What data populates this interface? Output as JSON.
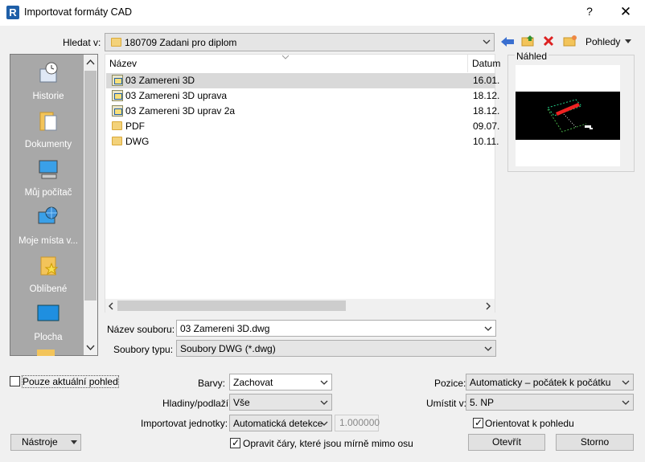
{
  "window": {
    "title": "Importovat formáty CAD",
    "help": "?",
    "close": "✕"
  },
  "lookin": {
    "label": "Hledat v:",
    "value": "180709 Zadani pro diplom"
  },
  "toolbar": {
    "views_label": "Pohledy"
  },
  "places": [
    {
      "label": "Historie",
      "icon": "history-icon"
    },
    {
      "label": "Dokumenty",
      "icon": "documents-icon"
    },
    {
      "label": "Můj počítač",
      "icon": "computer-icon"
    },
    {
      "label": "Moje místa v...",
      "icon": "network-icon"
    },
    {
      "label": "Oblíbené",
      "icon": "favorites-icon"
    },
    {
      "label": "Plocha",
      "icon": "desktop-icon"
    }
  ],
  "filelist": {
    "headers": {
      "name": "Název",
      "date": "Datum"
    },
    "rows": [
      {
        "name": "03 Zamereni 3D",
        "date": "16.01.",
        "type": "dwg",
        "selected": true
      },
      {
        "name": "03 Zamereni 3D uprava",
        "date": "18.12.",
        "type": "dwg"
      },
      {
        "name": "03 Zamereni 3D uprav 2a",
        "date": "18.12.",
        "type": "dwg"
      },
      {
        "name": "PDF",
        "date": "09.07.",
        "type": "folder"
      },
      {
        "name": "DWG",
        "date": "10.11.",
        "type": "folder"
      }
    ]
  },
  "preview": {
    "label": "Náhled"
  },
  "filename": {
    "label": "Název souboru:",
    "value": "03 Zamereni 3D.dwg"
  },
  "filetype": {
    "label": "Soubory typu:",
    "value": "Soubory DWG  (*.dwg)"
  },
  "options": {
    "current_view_only": {
      "label": "Pouze aktuální pohled",
      "checked": false
    },
    "colors": {
      "label": "Barvy:",
      "value": "Zachovat"
    },
    "layers": {
      "label": "Hladiny/podlaží:",
      "value": "Vše"
    },
    "units": {
      "label": "Importovat jednotky:",
      "value": "Automatická detekce",
      "factor": "1.000000"
    },
    "correct_lines": {
      "label": "Opravit čáry, které jsou mírně mimo osu",
      "checked": true
    },
    "position": {
      "label": "Pozice:",
      "value": "Automaticky – počátek k počátku"
    },
    "place_at": {
      "label": "Umístit v:",
      "value": "5. NP"
    },
    "orient_to_view": {
      "label": "Orientovat k pohledu",
      "checked": true
    }
  },
  "buttons": {
    "tools": "Nástroje",
    "open": "Otevřít",
    "cancel": "Storno"
  }
}
